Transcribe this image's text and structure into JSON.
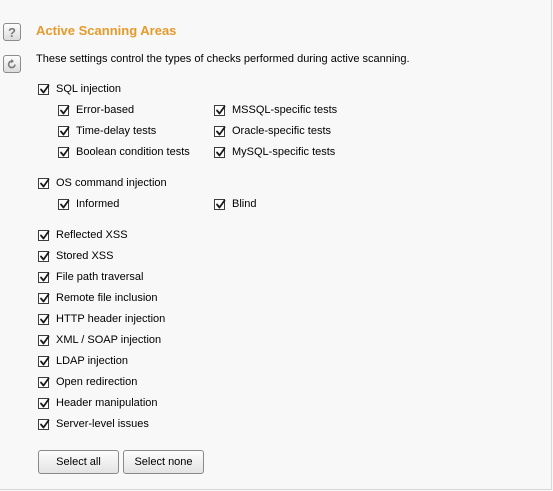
{
  "section": {
    "title": "Active Scanning Areas",
    "description": "These settings control the types of checks performed during active scanning."
  },
  "side_buttons": {
    "help_icon": "question-mark-icon",
    "reset_icon": "refresh-arrow-icon",
    "help_glyph": "?"
  },
  "checks": {
    "sql_injection": {
      "label": "SQL injection",
      "checked": true
    },
    "error_based": {
      "label": "Error-based",
      "checked": true
    },
    "time_delay": {
      "label": "Time-delay tests",
      "checked": true
    },
    "boolean_condition": {
      "label": "Boolean condition tests",
      "checked": true
    },
    "mssql": {
      "label": "MSSQL-specific tests",
      "checked": true
    },
    "oracle": {
      "label": "Oracle-specific tests",
      "checked": true
    },
    "mysql": {
      "label": "MySQL-specific tests",
      "checked": true
    },
    "os_command": {
      "label": "OS command injection",
      "checked": true
    },
    "informed": {
      "label": "Informed",
      "checked": true
    },
    "blind": {
      "label": "Blind",
      "checked": true
    },
    "reflected_xss": {
      "label": "Reflected XSS",
      "checked": true
    },
    "stored_xss": {
      "label": "Stored XSS",
      "checked": true
    },
    "file_path": {
      "label": "File path traversal",
      "checked": true
    },
    "remote_file": {
      "label": "Remote file inclusion",
      "checked": true
    },
    "http_header": {
      "label": "HTTP header injection",
      "checked": true
    },
    "xml_soap": {
      "label": "XML / SOAP injection",
      "checked": true
    },
    "ldap": {
      "label": "LDAP injection",
      "checked": true
    },
    "open_redirect": {
      "label": "Open redirection",
      "checked": true
    },
    "header_manip": {
      "label": "Header manipulation",
      "checked": true
    },
    "server_level": {
      "label": "Server-level issues",
      "checked": true
    }
  },
  "buttons": {
    "select_all": "Select all",
    "select_none": "Select none"
  },
  "colors": {
    "title": "#e59a2b",
    "background": "#f8f8f8"
  }
}
